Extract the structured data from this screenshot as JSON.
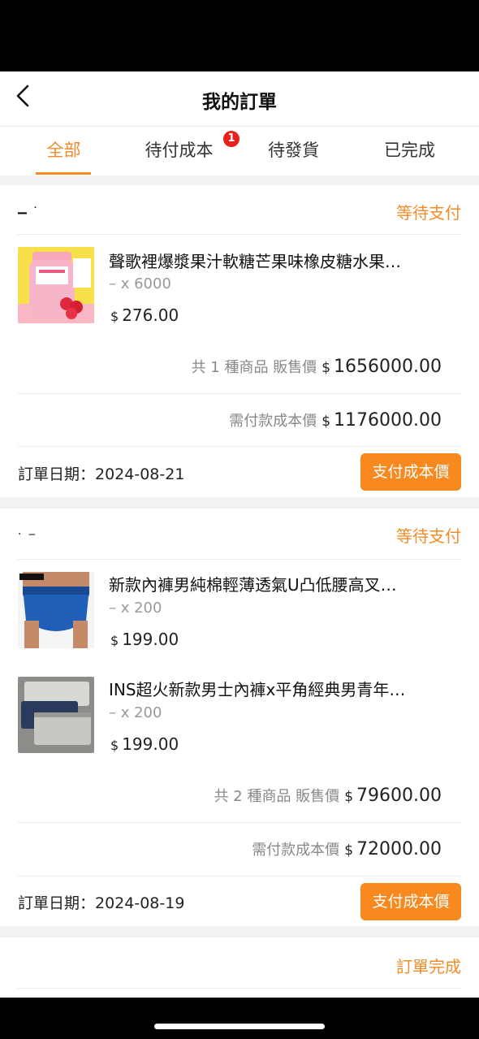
{
  "header": {
    "title": "我的訂單"
  },
  "tabs": [
    {
      "label": "全部",
      "active": true
    },
    {
      "label": "待付成本",
      "badge": "1"
    },
    {
      "label": "待發貨"
    },
    {
      "label": "已完成"
    }
  ],
  "orders": [
    {
      "store": "▁ ·",
      "status": "等待支付",
      "items": [
        {
          "name": "聲歌裡爆漿果汁軟糖芒果味橡皮糖水果…",
          "qty": "– x 6000",
          "price": "276.00"
        }
      ],
      "summary": {
        "count_label": "共 1 種商品 販售價",
        "sale_amount": "1656000.00",
        "cost_label": "需付款成本價",
        "cost_amount": "1176000.00"
      },
      "date": "訂單日期：2024-08-21",
      "pay_label": "支付成本價"
    },
    {
      "store": "·                 ‒",
      "status": "等待支付",
      "items": [
        {
          "name": "新款內褲男純棉輕薄透氣U凸低腰高叉…",
          "qty": "– x 200",
          "price": "199.00"
        },
        {
          "name": "INS超火新款男士內褲x平角經典男青年…",
          "qty": "– x 200",
          "price": "199.00"
        }
      ],
      "summary": {
        "count_label": "共 2 種商品 販售價",
        "sale_amount": "79600.00",
        "cost_label": "需付款成本價",
        "cost_amount": "72000.00"
      },
      "date": "訂單日期：2024-08-19",
      "pay_label": "支付成本價"
    },
    {
      "status": "訂單完成"
    }
  ],
  "currency": "$",
  "colors": {
    "accent": "#f28c28",
    "badge": "#e8221b"
  },
  "icons": {
    "back": "chevron-left-icon"
  }
}
